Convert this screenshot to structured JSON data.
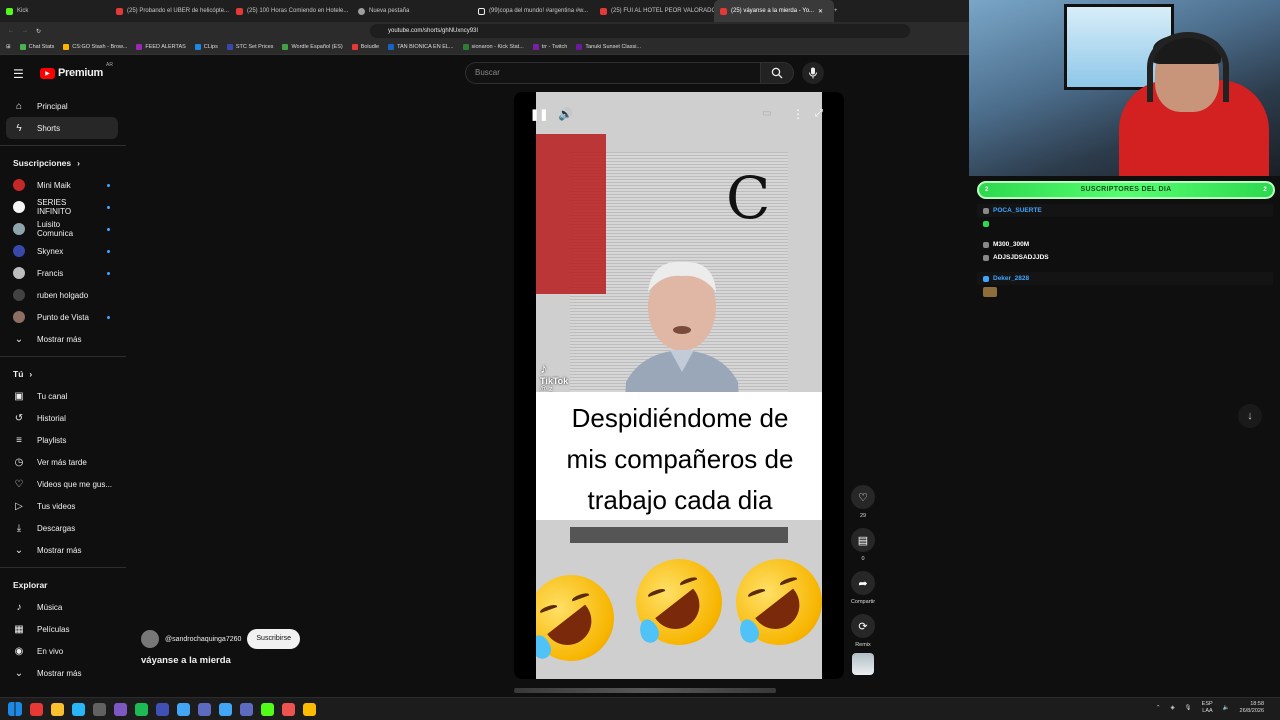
{
  "browser": {
    "tabs": [
      {
        "label": "Kick",
        "fav": "kick"
      },
      {
        "label": "(25) Probando el UBER de helicópte...",
        "fav": "yt"
      },
      {
        "label": "(25) 100 Horas Comiendo en Hotele...",
        "fav": "yt"
      },
      {
        "label": "Nueva pestaña",
        "fav": "grey"
      },
      {
        "label": "(99)copa del mundo! #argentina #w...",
        "fav": "tt"
      },
      {
        "label": "(25) FUI AL HOTEL PEOR VALORADO...",
        "fav": "yt"
      },
      {
        "label": "(25) váyanse a la mierda - Yo...",
        "fav": "yt",
        "active": true
      }
    ],
    "url": "youtube.com/shorts/ghNUxncy93I",
    "bookmarks": [
      "Chat Stats",
      "CS:GO Stash - Brow...",
      "FEED ALERTAS",
      "CLips",
      "STC Set Prices",
      "Wordle Español (ES)",
      "Boludle",
      "TAN BIONICA EN EL...",
      "sionaron - Kick Stat...",
      "trr - Twitch",
      "Tanuki Sunset Classi..."
    ],
    "bookmark_colors": [
      "#4caf50",
      "#ffb300",
      "#9c27b0",
      "#1e88e5",
      "#3949ab",
      "#43a047",
      "#e53935",
      "#1565c0",
      "#2e7d32",
      "#7b1fa2",
      "#6a1b9a"
    ]
  },
  "youtube": {
    "logo": "Premium",
    "logo_sup": "AR",
    "search_placeholder": "Buscar",
    "sidebar": {
      "main": [
        {
          "label": "Principal",
          "icon": "home-icon",
          "glyph": "⌂"
        },
        {
          "label": "Shorts",
          "icon": "shorts-icon",
          "glyph": "ϟ",
          "active": true
        }
      ],
      "subs_header": "Suscripciones",
      "subs": [
        {
          "label": "Mini Maik",
          "color": "#c62828",
          "dot": true
        },
        {
          "label": "SERIES INFINITO",
          "color": "#f5f5f5",
          "dot": true
        },
        {
          "label": "Luisito Comunica",
          "color": "#90a4ae",
          "dot": true
        },
        {
          "label": "Skynex",
          "color": "#3949ab",
          "dot": true
        },
        {
          "label": "Francis",
          "color": "#bdbdbd",
          "dot": true
        },
        {
          "label": "ruben holgado",
          "color": "#424242",
          "dot": false
        },
        {
          "label": "Punto de Vista",
          "color": "#8d6e63",
          "dot": true
        }
      ],
      "subs_more": "Mostrar más",
      "you_header": "Tú",
      "you": [
        {
          "label": "Tu canal",
          "icon": "channel-icon",
          "glyph": "▣"
        },
        {
          "label": "Historial",
          "icon": "history-icon",
          "glyph": "↺"
        },
        {
          "label": "Playlists",
          "icon": "playlist-icon",
          "glyph": "≡"
        },
        {
          "label": "Ver más tarde",
          "icon": "clock-icon",
          "glyph": "◷"
        },
        {
          "label": "Videos que me gus...",
          "icon": "like-icon",
          "glyph": "♡"
        },
        {
          "label": "Tus videos",
          "icon": "video-icon",
          "glyph": "▷"
        },
        {
          "label": "Descargas",
          "icon": "download-icon",
          "glyph": "⤓"
        }
      ],
      "you_more": "Mostrar más",
      "explore_header": "Explorar",
      "explore": [
        {
          "label": "Música",
          "icon": "music-icon",
          "glyph": "♪"
        },
        {
          "label": "Películas",
          "icon": "movies-icon",
          "glyph": "▦"
        },
        {
          "label": "En vivo",
          "icon": "live-icon",
          "glyph": "◉"
        }
      ],
      "explore_more": "Mostrar más"
    },
    "short": {
      "caption_lines": [
        "Despidiéndome de",
        "mis compañeros de",
        "trabajo cada dia"
      ],
      "watermark": "TikTok",
      "watermark_handle": "@ z",
      "channel": "@sandrochaquinga7260",
      "subscribe": "Suscribirse",
      "title": "váyanse a la mierda"
    },
    "actions": [
      {
        "name": "like-button",
        "icon": "like-icon",
        "glyph": "♡",
        "label": "29"
      },
      {
        "name": "comment-button",
        "icon": "comment-icon",
        "glyph": "▤",
        "label": "0"
      },
      {
        "name": "share-button",
        "icon": "share-icon",
        "glyph": "➦",
        "label": "Compartir"
      },
      {
        "name": "remix-button",
        "icon": "remix-icon",
        "glyph": "⟳",
        "label": "Remix"
      }
    ]
  },
  "overlay": {
    "sub_banner": "SUSCRIPTORES DEL DIA",
    "sub_count_left": "2",
    "sub_count_right": "2",
    "chat": [
      {
        "user": "POCA_SUERTE",
        "color": "#3ea6ff"
      },
      {
        "user": "",
        "color": "#2ed84e"
      },
      {
        "user": "M300_300M",
        "color": "#ffffff"
      },
      {
        "user": "ADJSJDSADJJDS",
        "color": "#ffffff"
      },
      {
        "user": "Deker_2828",
        "color": "#3ea6ff"
      }
    ]
  },
  "taskbar": {
    "lang": "ESP",
    "lang2": "LAA",
    "time": "18:58",
    "date": "26/8/2026",
    "app_colors": [
      "#1e88e5",
      "#e53935",
      "#fbc02d",
      "#29b6f6",
      "#616161",
      "#7e57c2",
      "#1db954",
      "#3f51b5",
      "#42a5f5",
      "#5c6bc0",
      "#42a5f5",
      "#5c6bc0",
      "#53fc18",
      "#ef5350",
      "#fbbc04"
    ]
  }
}
